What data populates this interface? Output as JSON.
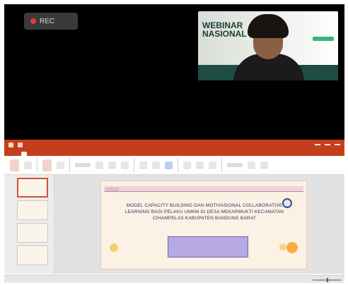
{
  "recording": {
    "label": "REC"
  },
  "webcam": {
    "banner_text": "WEBINAR\nNASIONAL"
  },
  "slide": {
    "title": "MODEL CAPACITY BUILDING DAN MOTIVASIONAL COLLABORATIVE LEARNING BAGI PELAKU UMKM DI DESA MEKARMUKTI KECAMATAN CIHAMPELAS KABUPATEN BANDUNG BARAT"
  }
}
